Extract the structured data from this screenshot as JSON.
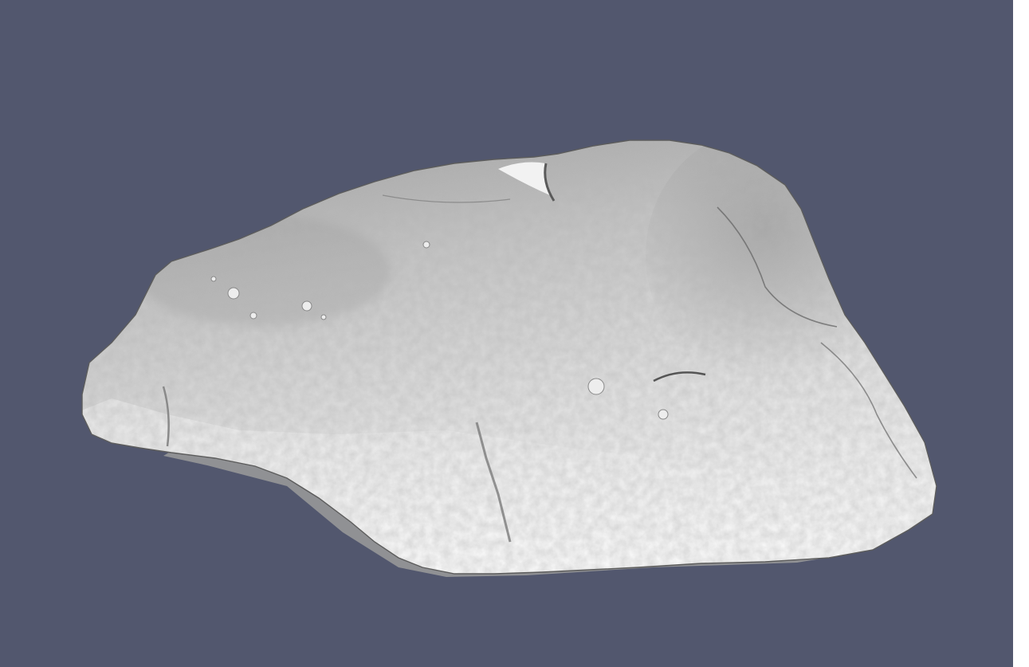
{
  "viewer": {
    "background_color": "#52576e",
    "side_strip_color": "#ffffff",
    "model": {
      "kind": "scanned-rock-mesh",
      "render_style": "flat-shaded-white",
      "base_color": "#d8d8d8",
      "highlight_color": "#f6f6f6",
      "shadow_color": "#6a6a6a"
    }
  }
}
